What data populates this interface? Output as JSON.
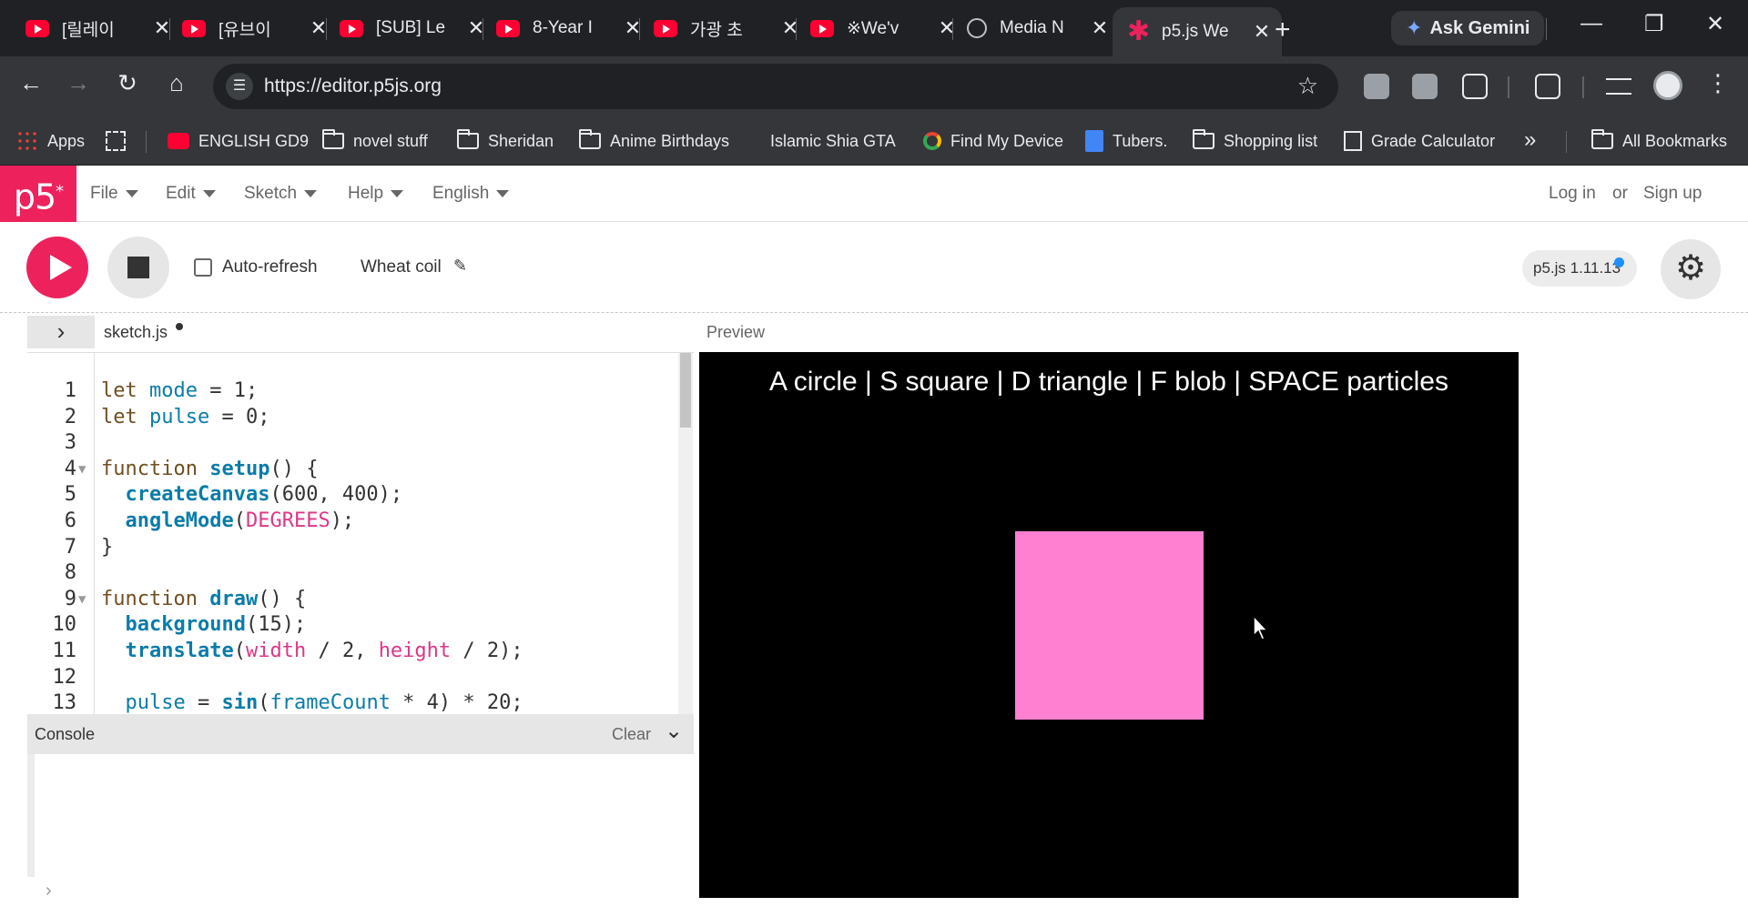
{
  "browser": {
    "tabs": [
      {
        "title": "[릴레이",
        "icon": "youtube-icon"
      },
      {
        "title": "[유브이",
        "icon": "youtube-icon"
      },
      {
        "title": "[SUB] Le",
        "icon": "youtube-icon"
      },
      {
        "title": "8-Year I",
        "icon": "youtube-icon"
      },
      {
        "title": "가광 초",
        "icon": "youtube-icon"
      },
      {
        "title": "※We'v",
        "icon": "youtube-icon"
      },
      {
        "title": "Media N",
        "icon": "globe-icon"
      },
      {
        "title": "p5.js We",
        "icon": "p5-icon",
        "active": true
      }
    ],
    "new_tab": "+",
    "gemini_label": "Ask Gemini",
    "window_controls": {
      "minimize": "—",
      "restore": "❐",
      "close": "✕"
    },
    "nav": {
      "back": "←",
      "forward": "→",
      "reload": "↻",
      "home": "⌂"
    },
    "url": "https://editor.p5js.org",
    "bookmark_star": "☆",
    "bookmarks": [
      {
        "label": "Apps",
        "icon": "apps-icon"
      },
      {
        "label": "",
        "icon": "grid-icon"
      },
      {
        "label": "ENGLISH GD9",
        "icon": "youtube-icon"
      },
      {
        "label": "novel stuff",
        "icon": "folder-icon"
      },
      {
        "label": "Sheridan",
        "icon": "folder-icon"
      },
      {
        "label": "Anime Birthdays",
        "icon": "folder-icon"
      },
      {
        "label": "Islamic Shia GTA",
        "icon": "bookmark-icon"
      },
      {
        "label": "Find My Device",
        "icon": "location-icon"
      },
      {
        "label": "Tubers.",
        "icon": "doc-icon"
      },
      {
        "label": "Shopping list",
        "icon": "folder-icon"
      },
      {
        "label": "Grade Calculator",
        "icon": "calculator-icon"
      }
    ],
    "bookmarks_more": "»",
    "all_bookmarks": "All Bookmarks"
  },
  "p5": {
    "logo": "p5",
    "logo_sup": "*",
    "menu": [
      "File",
      "Edit",
      "Sketch",
      "Help",
      "English"
    ],
    "auth": {
      "login": "Log in",
      "or": "or",
      "signup": "Sign up"
    },
    "auto_refresh_label": "Auto-refresh",
    "auto_refresh_checked": false,
    "sketch_name": "Wheat coil",
    "pencil": "✎",
    "version": "p5.js 1.11.13",
    "gear": "⚙",
    "expander": "›",
    "file_name": "sketch.js",
    "preview_label": "Preview",
    "code_lines": [
      {
        "num": "1",
        "fold": "",
        "tokens": [
          {
            "t": "let ",
            "c": "k"
          },
          {
            "t": "mode",
            "c": "v"
          },
          {
            "t": " = 1;",
            "c": "n"
          }
        ]
      },
      {
        "num": "2",
        "fold": "",
        "tokens": [
          {
            "t": "let ",
            "c": "k"
          },
          {
            "t": "pulse",
            "c": "v"
          },
          {
            "t": " = 0;",
            "c": "n"
          }
        ]
      },
      {
        "num": "3",
        "fold": "",
        "tokens": []
      },
      {
        "num": "4",
        "fold": "▼",
        "tokens": [
          {
            "t": "function ",
            "c": "k"
          },
          {
            "t": "setup",
            "c": "f"
          },
          {
            "t": "() {",
            "c": "n"
          }
        ]
      },
      {
        "num": "5",
        "fold": "",
        "tokens": [
          {
            "t": "  ",
            "c": "n"
          },
          {
            "t": "createCanvas",
            "c": "f"
          },
          {
            "t": "(600, 400);",
            "c": "n"
          }
        ]
      },
      {
        "num": "6",
        "fold": "",
        "tokens": [
          {
            "t": "  ",
            "c": "n"
          },
          {
            "t": "angleMode",
            "c": "f"
          },
          {
            "t": "(",
            "c": "n"
          },
          {
            "t": "DEGREES",
            "c": "c"
          },
          {
            "t": ");",
            "c": "n"
          }
        ]
      },
      {
        "num": "7",
        "fold": "",
        "tokens": [
          {
            "t": "}",
            "c": "n"
          }
        ]
      },
      {
        "num": "8",
        "fold": "",
        "tokens": []
      },
      {
        "num": "9",
        "fold": "▼",
        "tokens": [
          {
            "t": "function ",
            "c": "k"
          },
          {
            "t": "draw",
            "c": "f"
          },
          {
            "t": "() {",
            "c": "n"
          }
        ]
      },
      {
        "num": "10",
        "fold": "",
        "tokens": [
          {
            "t": "  ",
            "c": "n"
          },
          {
            "t": "background",
            "c": "f"
          },
          {
            "t": "(15);",
            "c": "n"
          }
        ]
      },
      {
        "num": "11",
        "fold": "",
        "tokens": [
          {
            "t": "  ",
            "c": "n"
          },
          {
            "t": "translate",
            "c": "f"
          },
          {
            "t": "(",
            "c": "n"
          },
          {
            "t": "width",
            "c": "c"
          },
          {
            "t": " / 2, ",
            "c": "n"
          },
          {
            "t": "height",
            "c": "c"
          },
          {
            "t": " / 2);",
            "c": "n"
          }
        ]
      },
      {
        "num": "12",
        "fold": "",
        "tokens": []
      },
      {
        "num": "13",
        "fold": "",
        "tokens": [
          {
            "t": "  ",
            "c": "n"
          },
          {
            "t": "pulse",
            "c": "v"
          },
          {
            "t": " = ",
            "c": "n"
          },
          {
            "t": "sin",
            "c": "f"
          },
          {
            "t": "(",
            "c": "n"
          },
          {
            "t": "frameCount",
            "c": "v"
          },
          {
            "t": " * 4) * 20;",
            "c": "n"
          }
        ]
      }
    ],
    "console_title": "Console",
    "console_clear": "Clear",
    "console_chevron": "⌄",
    "console_prompt": "›",
    "canvas_text": "A circle | S square | D triangle | F blob | SPACE particles",
    "canvas_shape_color": "#ff80d0",
    "accent_color": "#ed225d"
  }
}
